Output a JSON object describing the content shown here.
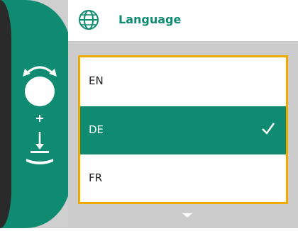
{
  "header": {
    "title": "Language",
    "icon": "globe-icon"
  },
  "languages": [
    {
      "label": "EN",
      "selected": false
    },
    {
      "label": "DE",
      "selected": true
    },
    {
      "label": "FR",
      "selected": false
    }
  ],
  "colors": {
    "accent": "#0f8b72",
    "focus_border": "#f2a900",
    "background": "#cccccc"
  },
  "rail": {
    "icons": [
      "rotate-knob-icon",
      "plus-icon",
      "confirm-press-icon"
    ]
  },
  "scroll": {
    "more_below": true
  }
}
